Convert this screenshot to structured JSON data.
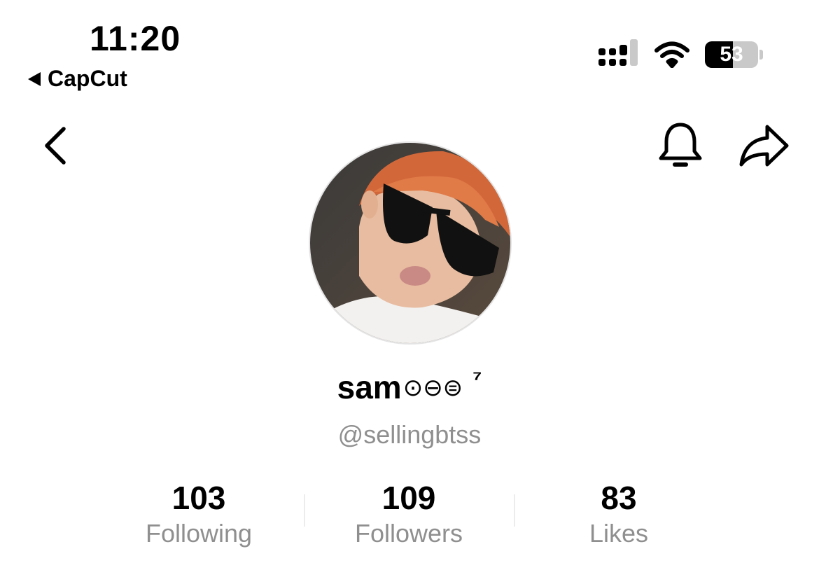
{
  "status_bar": {
    "time": "11:20",
    "back_app_label": "CapCut",
    "battery_level": "53",
    "icons": [
      "cellular-signal-icon",
      "wifi-icon",
      "battery-icon"
    ]
  },
  "nav": {
    "icons": [
      "chevron-left-icon",
      "bell-icon",
      "share-arrow-icon"
    ]
  },
  "profile": {
    "display_name": "sam",
    "display_name_glyphs": "⊙⊖⊜",
    "display_name_sup": "⁷",
    "username": "@sellingbtss"
  },
  "stats": [
    {
      "value": "103",
      "label": "Following"
    },
    {
      "value": "109",
      "label": "Followers"
    },
    {
      "value": "83",
      "label": "Likes"
    }
  ],
  "colors": {
    "text_primary": "#000000",
    "text_secondary": "#8f8f8f",
    "background": "#ffffff"
  }
}
